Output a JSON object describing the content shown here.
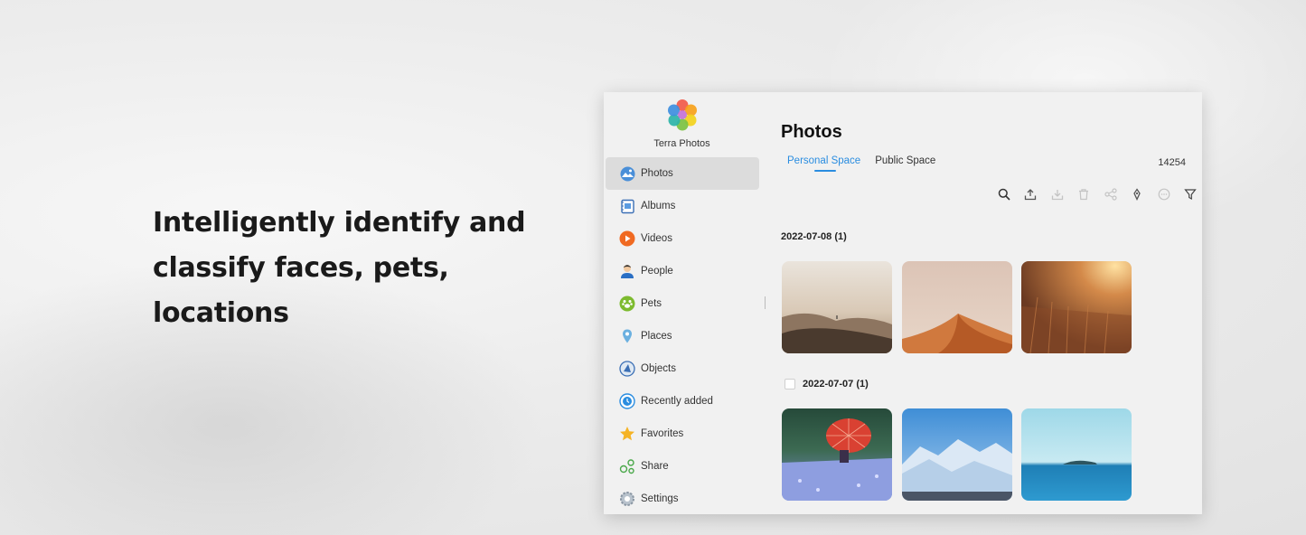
{
  "marketing": {
    "headline_line1": "Intelligently identify and",
    "headline_line2": "classify faces, pets, locations"
  },
  "app": {
    "name": "Terra Photos"
  },
  "sidebar": {
    "items": [
      {
        "label": "Photos",
        "icon": "photos-icon",
        "active": true
      },
      {
        "label": "Albums",
        "icon": "albums-icon"
      },
      {
        "label": "Videos",
        "icon": "videos-icon"
      },
      {
        "label": "People",
        "icon": "people-icon"
      },
      {
        "label": "Pets",
        "icon": "pets-icon"
      },
      {
        "label": "Places",
        "icon": "places-icon"
      },
      {
        "label": "Objects",
        "icon": "objects-icon"
      },
      {
        "label": "Recently added",
        "icon": "recently-added-icon"
      },
      {
        "label": "Favorites",
        "icon": "star-icon"
      },
      {
        "label": "Share",
        "icon": "share-icon"
      },
      {
        "label": "Settings",
        "icon": "gear-icon"
      }
    ]
  },
  "main": {
    "title": "Photos",
    "tabs": [
      {
        "label": "Personal Space",
        "active": true
      },
      {
        "label": "Public Space"
      }
    ],
    "count": "14254",
    "toolbar": [
      "search-icon",
      "upload-icon",
      "download-icon",
      "delete-icon",
      "share-icon",
      "tag-icon",
      "more-icon",
      "filter-icon"
    ],
    "groups": [
      {
        "date": "2022-07-08 (1)",
        "photos": [
          "desert-dunes-photo",
          "sand-dune-photo",
          "wheat-field-photo"
        ]
      },
      {
        "date": "2022-07-07 (1)",
        "photos": [
          "red-umbrella-photo",
          "snowy-mountains-photo",
          "ocean-island-photo"
        ]
      }
    ]
  },
  "colors": {
    "accent": "#2a8de0",
    "active_nav_bg": "#dcdcdc"
  }
}
